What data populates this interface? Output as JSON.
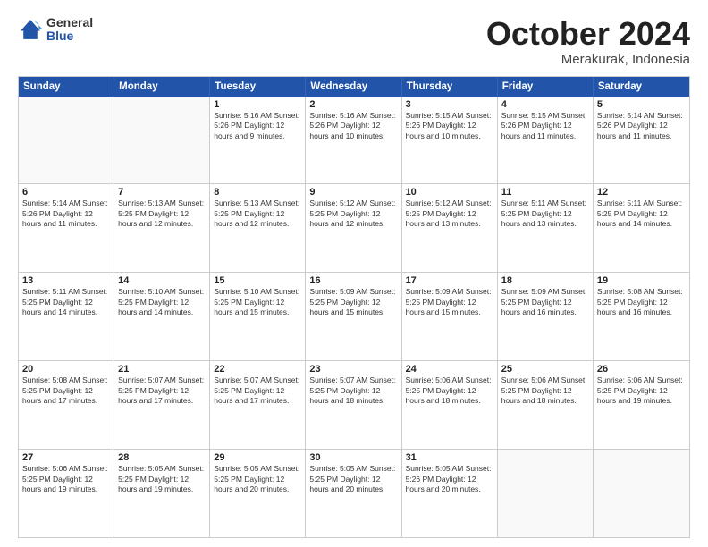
{
  "logo": {
    "general": "General",
    "blue": "Blue"
  },
  "header": {
    "month": "October 2024",
    "location": "Merakurak, Indonesia"
  },
  "weekdays": [
    "Sunday",
    "Monday",
    "Tuesday",
    "Wednesday",
    "Thursday",
    "Friday",
    "Saturday"
  ],
  "rows": [
    [
      {
        "day": "",
        "empty": true
      },
      {
        "day": "",
        "empty": true
      },
      {
        "day": "1",
        "info": "Sunrise: 5:16 AM\nSunset: 5:26 PM\nDaylight: 12 hours\nand 9 minutes."
      },
      {
        "day": "2",
        "info": "Sunrise: 5:16 AM\nSunset: 5:26 PM\nDaylight: 12 hours\nand 10 minutes."
      },
      {
        "day": "3",
        "info": "Sunrise: 5:15 AM\nSunset: 5:26 PM\nDaylight: 12 hours\nand 10 minutes."
      },
      {
        "day": "4",
        "info": "Sunrise: 5:15 AM\nSunset: 5:26 PM\nDaylight: 12 hours\nand 11 minutes."
      },
      {
        "day": "5",
        "info": "Sunrise: 5:14 AM\nSunset: 5:26 PM\nDaylight: 12 hours\nand 11 minutes."
      }
    ],
    [
      {
        "day": "6",
        "info": "Sunrise: 5:14 AM\nSunset: 5:26 PM\nDaylight: 12 hours\nand 11 minutes."
      },
      {
        "day": "7",
        "info": "Sunrise: 5:13 AM\nSunset: 5:25 PM\nDaylight: 12 hours\nand 12 minutes."
      },
      {
        "day": "8",
        "info": "Sunrise: 5:13 AM\nSunset: 5:25 PM\nDaylight: 12 hours\nand 12 minutes."
      },
      {
        "day": "9",
        "info": "Sunrise: 5:12 AM\nSunset: 5:25 PM\nDaylight: 12 hours\nand 12 minutes."
      },
      {
        "day": "10",
        "info": "Sunrise: 5:12 AM\nSunset: 5:25 PM\nDaylight: 12 hours\nand 13 minutes."
      },
      {
        "day": "11",
        "info": "Sunrise: 5:11 AM\nSunset: 5:25 PM\nDaylight: 12 hours\nand 13 minutes."
      },
      {
        "day": "12",
        "info": "Sunrise: 5:11 AM\nSunset: 5:25 PM\nDaylight: 12 hours\nand 14 minutes."
      }
    ],
    [
      {
        "day": "13",
        "info": "Sunrise: 5:11 AM\nSunset: 5:25 PM\nDaylight: 12 hours\nand 14 minutes."
      },
      {
        "day": "14",
        "info": "Sunrise: 5:10 AM\nSunset: 5:25 PM\nDaylight: 12 hours\nand 14 minutes."
      },
      {
        "day": "15",
        "info": "Sunrise: 5:10 AM\nSunset: 5:25 PM\nDaylight: 12 hours\nand 15 minutes."
      },
      {
        "day": "16",
        "info": "Sunrise: 5:09 AM\nSunset: 5:25 PM\nDaylight: 12 hours\nand 15 minutes."
      },
      {
        "day": "17",
        "info": "Sunrise: 5:09 AM\nSunset: 5:25 PM\nDaylight: 12 hours\nand 15 minutes."
      },
      {
        "day": "18",
        "info": "Sunrise: 5:09 AM\nSunset: 5:25 PM\nDaylight: 12 hours\nand 16 minutes."
      },
      {
        "day": "19",
        "info": "Sunrise: 5:08 AM\nSunset: 5:25 PM\nDaylight: 12 hours\nand 16 minutes."
      }
    ],
    [
      {
        "day": "20",
        "info": "Sunrise: 5:08 AM\nSunset: 5:25 PM\nDaylight: 12 hours\nand 17 minutes."
      },
      {
        "day": "21",
        "info": "Sunrise: 5:07 AM\nSunset: 5:25 PM\nDaylight: 12 hours\nand 17 minutes."
      },
      {
        "day": "22",
        "info": "Sunrise: 5:07 AM\nSunset: 5:25 PM\nDaylight: 12 hours\nand 17 minutes."
      },
      {
        "day": "23",
        "info": "Sunrise: 5:07 AM\nSunset: 5:25 PM\nDaylight: 12 hours\nand 18 minutes."
      },
      {
        "day": "24",
        "info": "Sunrise: 5:06 AM\nSunset: 5:25 PM\nDaylight: 12 hours\nand 18 minutes."
      },
      {
        "day": "25",
        "info": "Sunrise: 5:06 AM\nSunset: 5:25 PM\nDaylight: 12 hours\nand 18 minutes."
      },
      {
        "day": "26",
        "info": "Sunrise: 5:06 AM\nSunset: 5:25 PM\nDaylight: 12 hours\nand 19 minutes."
      }
    ],
    [
      {
        "day": "27",
        "info": "Sunrise: 5:06 AM\nSunset: 5:25 PM\nDaylight: 12 hours\nand 19 minutes."
      },
      {
        "day": "28",
        "info": "Sunrise: 5:05 AM\nSunset: 5:25 PM\nDaylight: 12 hours\nand 19 minutes."
      },
      {
        "day": "29",
        "info": "Sunrise: 5:05 AM\nSunset: 5:25 PM\nDaylight: 12 hours\nand 20 minutes."
      },
      {
        "day": "30",
        "info": "Sunrise: 5:05 AM\nSunset: 5:25 PM\nDaylight: 12 hours\nand 20 minutes."
      },
      {
        "day": "31",
        "info": "Sunrise: 5:05 AM\nSunset: 5:26 PM\nDaylight: 12 hours\nand 20 minutes."
      },
      {
        "day": "",
        "empty": true
      },
      {
        "day": "",
        "empty": true
      }
    ]
  ]
}
